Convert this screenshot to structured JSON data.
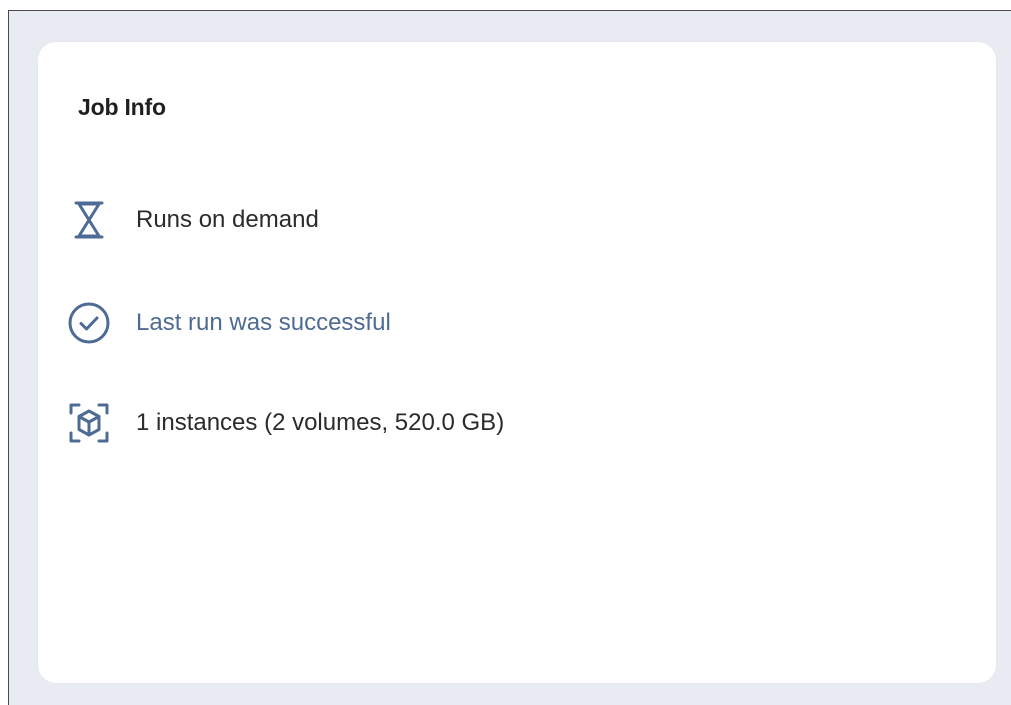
{
  "card": {
    "title": "Job Info",
    "items": [
      {
        "icon": "hourglass-icon",
        "text": "Runs on demand"
      },
      {
        "icon": "check-circle-icon",
        "text": "Last run was successful"
      },
      {
        "icon": "instance-box-icon",
        "text": "1 instances (2 volumes, 520.0 GB)"
      }
    ]
  },
  "colors": {
    "icon": "#4d6b94",
    "link_text": "#4d6b94",
    "page_background": "#e8ebf1",
    "card_background": "#ffffff"
  }
}
